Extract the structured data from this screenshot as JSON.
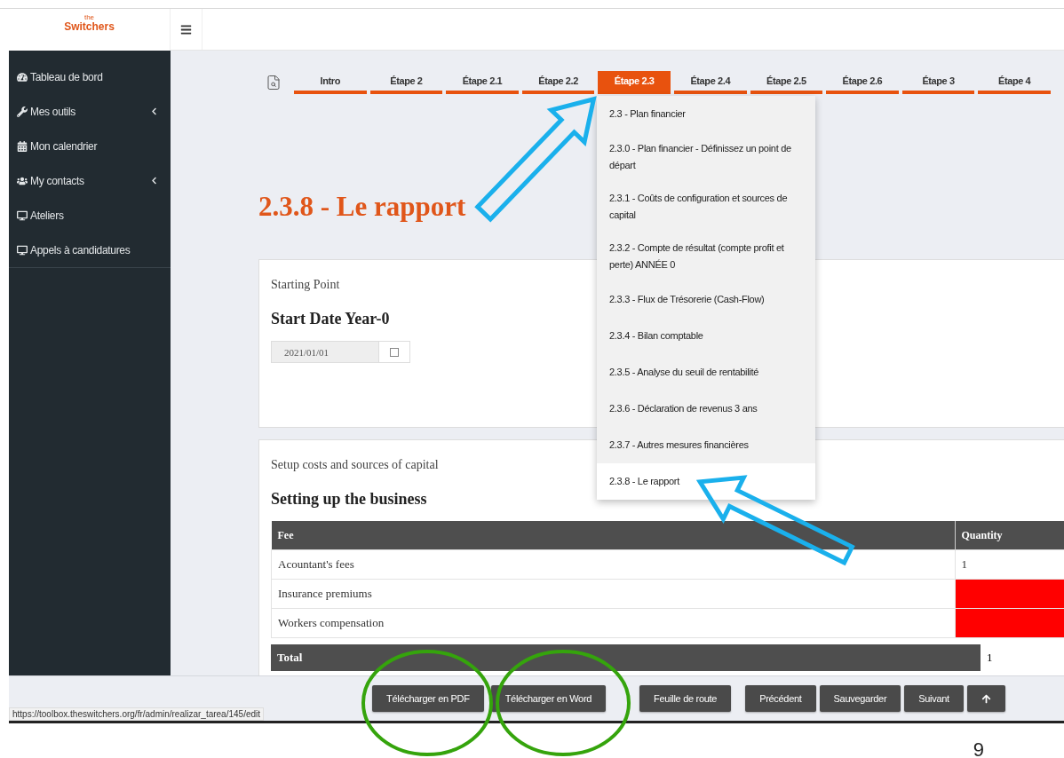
{
  "logo": {
    "top": "the",
    "name": "Switchers"
  },
  "sidebar": {
    "items": [
      {
        "label": "Tableau de bord",
        "kind": "dashboard",
        "has_children": false
      },
      {
        "label": "Mes outils",
        "kind": "tools",
        "has_children": true
      },
      {
        "label": "Mon calendrier",
        "kind": "calendar",
        "has_children": false
      },
      {
        "label": "My contacts",
        "kind": "contacts",
        "has_children": true
      },
      {
        "label": "Ateliers",
        "kind": "workshops",
        "has_children": false
      },
      {
        "label": "Appels à candidatures",
        "kind": "calls",
        "has_children": false
      }
    ]
  },
  "tabs": [
    {
      "label": "Intro",
      "selected": false
    },
    {
      "label": "Étape 2",
      "selected": false
    },
    {
      "label": "Étape 2.1",
      "selected": false
    },
    {
      "label": "Étape 2.2",
      "selected": false
    },
    {
      "label": "Étape 2.3",
      "selected": true
    },
    {
      "label": "Étape 2.4",
      "selected": false
    },
    {
      "label": "Étape 2.5",
      "selected": false
    },
    {
      "label": "Étape 2.6",
      "selected": false
    },
    {
      "label": "Étape 3",
      "selected": false
    },
    {
      "label": "Étape 4",
      "selected": false
    }
  ],
  "dropdown": {
    "items": [
      {
        "label": "2.3 - Plan financier",
        "selected": false
      },
      {
        "label": "2.3.0 - Plan financier - Définissez un point de départ",
        "selected": false
      },
      {
        "label": "2.3.1 - Coûts de configuration et sources de capital",
        "selected": false
      },
      {
        "label": "2.3.2 - Compte de résultat (compte profit et perte) ANNÉE 0",
        "selected": false
      },
      {
        "label": "2.3.3 - Flux de Trésorerie (Cash-Flow)",
        "selected": false
      },
      {
        "label": "2.3.4 - Bilan comptable",
        "selected": false
      },
      {
        "label": "2.3.5 - Analyse du seuil de rentabilité",
        "selected": false
      },
      {
        "label": "2.3.6 - Déclaration de revenus 3 ans",
        "selected": false
      },
      {
        "label": "2.3.7 - Autres mesures financières",
        "selected": false
      },
      {
        "label": "2.3.8 - Le rapport",
        "selected": true
      }
    ]
  },
  "page_title": "2.3.8 - Le rapport",
  "starting_point": {
    "caption": "Starting Point",
    "heading": "Start Date Year-0",
    "date_value": "2021/01/01"
  },
  "setup": {
    "caption": "Setup costs and sources of capital",
    "heading": "Setting up the business",
    "table": {
      "columns": [
        "Fee",
        "Quantity"
      ],
      "rows": [
        {
          "fee": "Acountant's fees",
          "quantity": "1",
          "invalid": false
        },
        {
          "fee": "Insurance premiums",
          "quantity": "",
          "invalid": true
        },
        {
          "fee": "Workers compensation",
          "quantity": "",
          "invalid": true
        }
      ],
      "total": {
        "label": "Total",
        "quantity": "1"
      }
    }
  },
  "footer": {
    "buttons": [
      {
        "label": "Télécharger en PDF",
        "kind": "text"
      },
      {
        "label": "Télécharger en Word",
        "kind": "text"
      },
      {
        "label": "Feuille de route",
        "kind": "text"
      },
      {
        "label": "Précédent",
        "kind": "text"
      },
      {
        "label": "Sauvegarder",
        "kind": "text"
      },
      {
        "label": "Suivant",
        "kind": "text"
      },
      {
        "kind": "up"
      }
    ]
  },
  "status_url": "https://toolbox.theswitchers.org/fr/admin/realizar_tarea/145/edit",
  "page_number": "9"
}
